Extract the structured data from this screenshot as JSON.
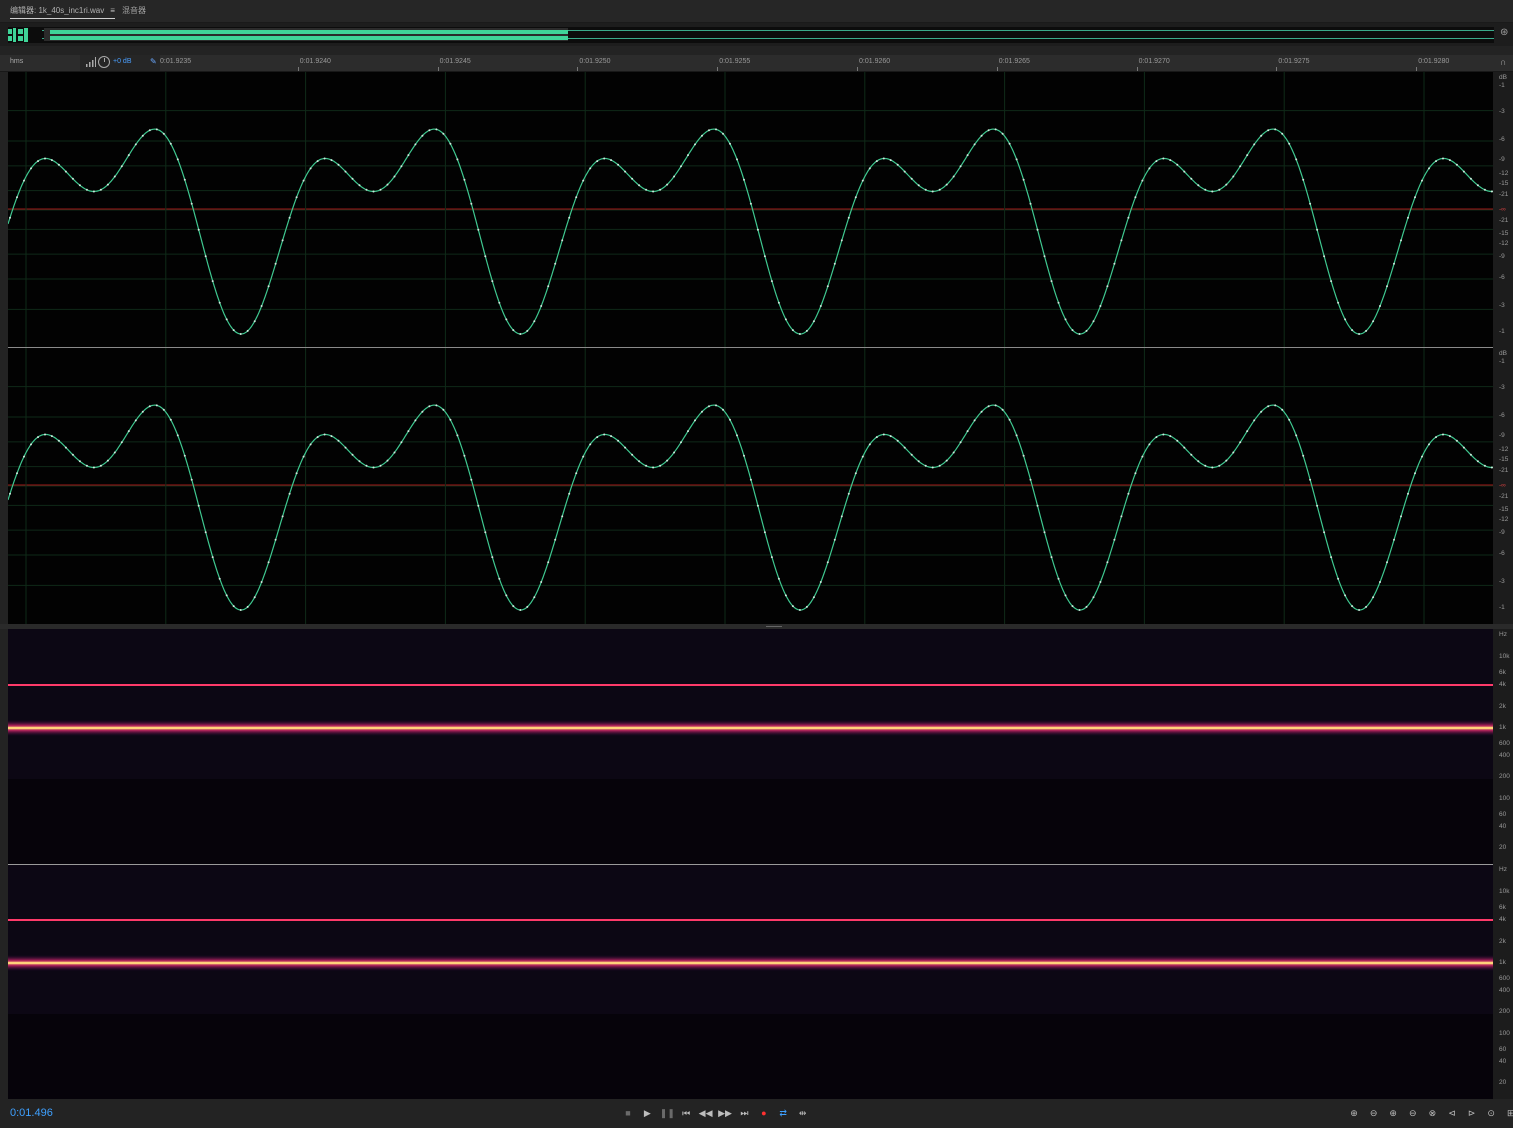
{
  "tabs": {
    "editor_label": "编辑器: 1k_40s_inc1ri.wav",
    "editor_menu": "≡",
    "mixer_label": "混音器"
  },
  "timeline": {
    "unit": "hms",
    "ticks": [
      "0:01.9235",
      "0:01.9240",
      "0:01.9245",
      "0:01.9250",
      "0:01.9255",
      "0:01.9260",
      "0:01.9265",
      "0:01.9270",
      "0:01.9275",
      "0:01.9280"
    ]
  },
  "hud": {
    "gain": "+0 dB"
  },
  "waveform": {
    "color": "#3fc890",
    "centerline_color": "#a01818",
    "scale_labels": [
      "dB",
      "-1",
      "-3",
      "-6",
      "-9",
      "-12",
      "-15",
      "-21",
      "-∞",
      "-21",
      "-15",
      "-12",
      "-9",
      "-6",
      "-3",
      "-1"
    ]
  },
  "spectrum": {
    "scale_labels": [
      "Hz",
      "10k",
      "6k",
      "4k",
      "2k",
      "1k",
      "600",
      "400",
      "200",
      "100",
      "60",
      "40",
      "20"
    ],
    "bands": [
      {
        "freq": "1k",
        "color": "#ffd27a"
      },
      {
        "freq": "4k",
        "color": "#ff3a6a"
      }
    ]
  },
  "transport": {
    "time": "0:01.496",
    "buttons": [
      {
        "name": "stop-button",
        "glyph": "■"
      },
      {
        "name": "play-button",
        "glyph": "▶"
      },
      {
        "name": "pause-button",
        "glyph": "❚❚"
      },
      {
        "name": "go-to-start-button",
        "glyph": "⏮"
      },
      {
        "name": "rewind-button",
        "glyph": "◀◀"
      },
      {
        "name": "fast-forward-button",
        "glyph": "▶▶"
      },
      {
        "name": "go-to-end-button",
        "glyph": "⏭"
      },
      {
        "name": "record-button",
        "glyph": "●"
      },
      {
        "name": "loop-button",
        "glyph": "⇄"
      },
      {
        "name": "skip-selection-button",
        "glyph": "⇹"
      }
    ],
    "record_color": "#ff3030",
    "accent_color": "#3ea0ff"
  },
  "zoom": {
    "buttons": [
      {
        "name": "zoom-in-amplitude-button",
        "glyph": "⊕"
      },
      {
        "name": "zoom-out-amplitude-button",
        "glyph": "⊖"
      },
      {
        "name": "zoom-in-time-button",
        "glyph": "⊕"
      },
      {
        "name": "zoom-out-time-button",
        "glyph": "⊖"
      },
      {
        "name": "zoom-out-full-button",
        "glyph": "⊗"
      },
      {
        "name": "zoom-in-selection-start-button",
        "glyph": "⊲"
      },
      {
        "name": "zoom-in-selection-end-button",
        "glyph": "⊳"
      },
      {
        "name": "zoom-selection-button",
        "glyph": "⊙"
      },
      {
        "name": "zoom-in-channel-button",
        "glyph": "⊞"
      },
      {
        "name": "zoom-reset-button",
        "glyph": "↺"
      }
    ]
  }
}
